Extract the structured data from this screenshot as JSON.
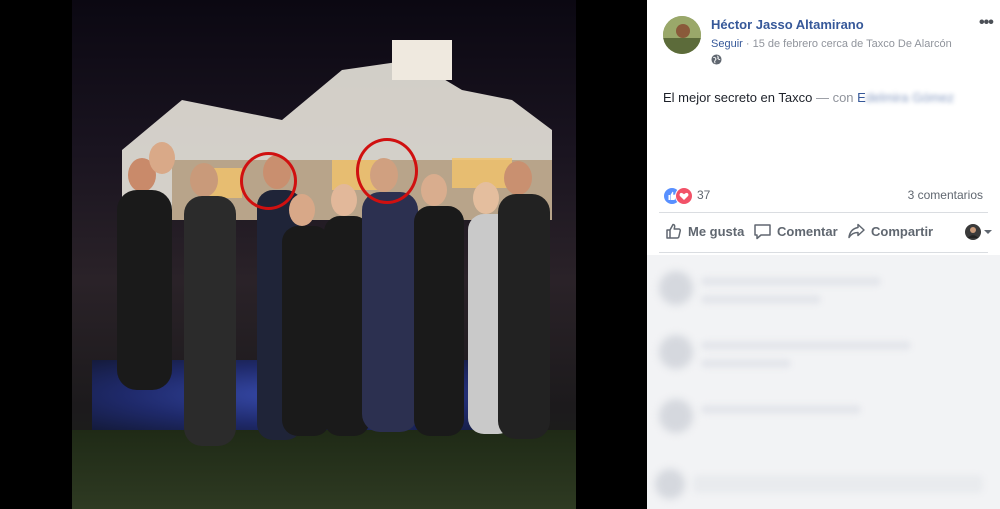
{
  "author": {
    "name": "Héctor Jasso Altamirano",
    "follow": "Seguir",
    "meta": "15 de febrero cerca de Taxco De Alarcón",
    "avatar_icon": "avatar-photo"
  },
  "post": {
    "text": "El mejor secreto en Taxco",
    "with_label": "— con",
    "tagged_visible": "E",
    "tagged_blurred": "delmira Gómez"
  },
  "stats": {
    "reactions": "37",
    "comments": "3 comentarios"
  },
  "actions": {
    "like": "Me gusta",
    "comment": "Comentar",
    "share": "Compartir"
  },
  "colors": {
    "link": "#365899",
    "muted": "#90949c",
    "annotation_circle": "#d01010"
  }
}
